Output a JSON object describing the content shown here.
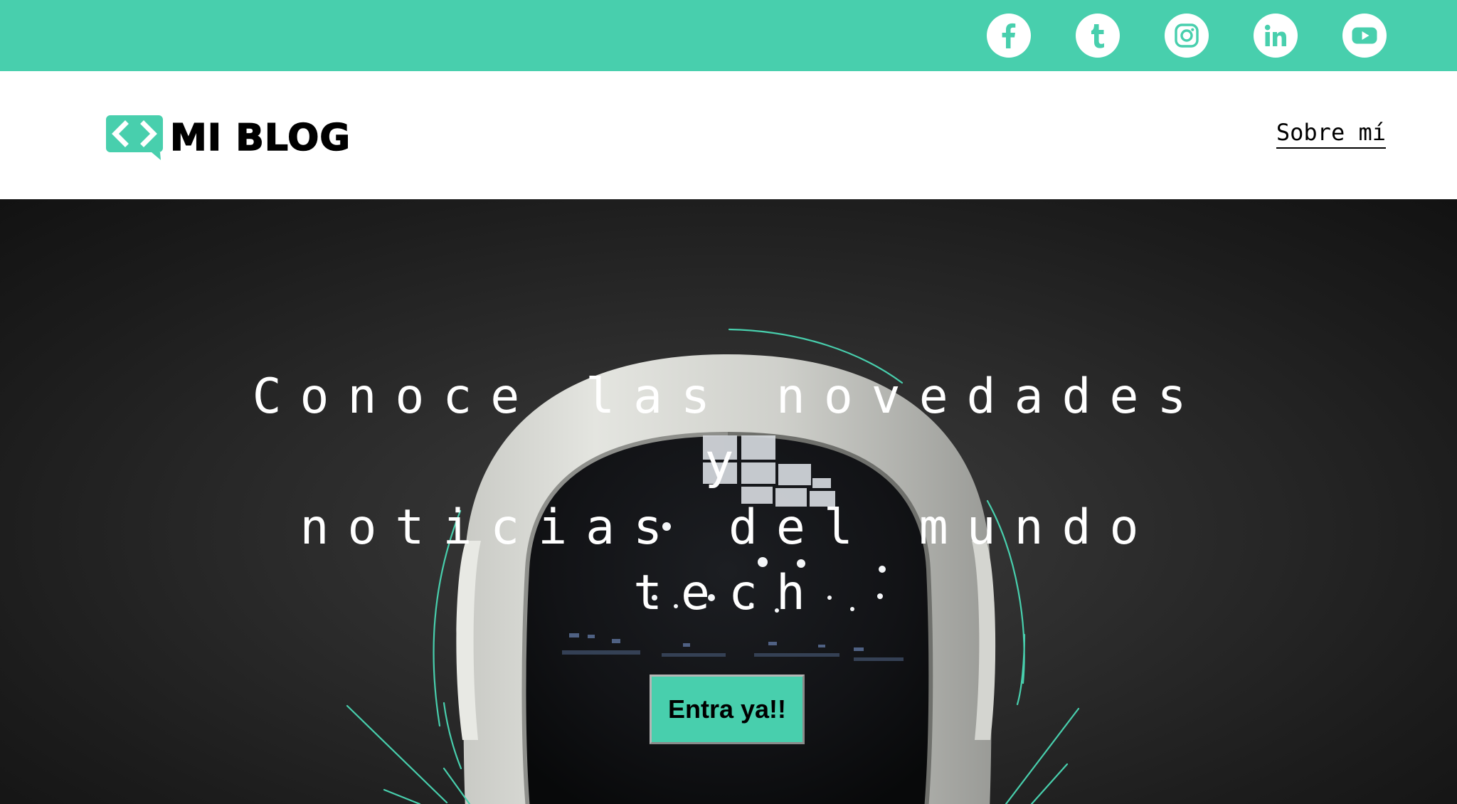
{
  "brand": {
    "name": "MI BLOG",
    "accent_color": "#48cfad"
  },
  "social": [
    {
      "name": "facebook",
      "icon": "facebook-icon"
    },
    {
      "name": "tumblr",
      "icon": "tumblr-icon"
    },
    {
      "name": "instagram",
      "icon": "instagram-icon"
    },
    {
      "name": "linkedin",
      "icon": "linkedin-icon"
    },
    {
      "name": "youtube",
      "icon": "youtube-icon"
    }
  ],
  "nav": {
    "about_label": "Sobre mí"
  },
  "hero": {
    "title_line1": "Conoce las novedades y",
    "title_line2": "noticias del mundo",
    "title_line3": "tech",
    "cta_label": "Entra ya!!",
    "background_icon": "astronaut-helmet-icon"
  }
}
